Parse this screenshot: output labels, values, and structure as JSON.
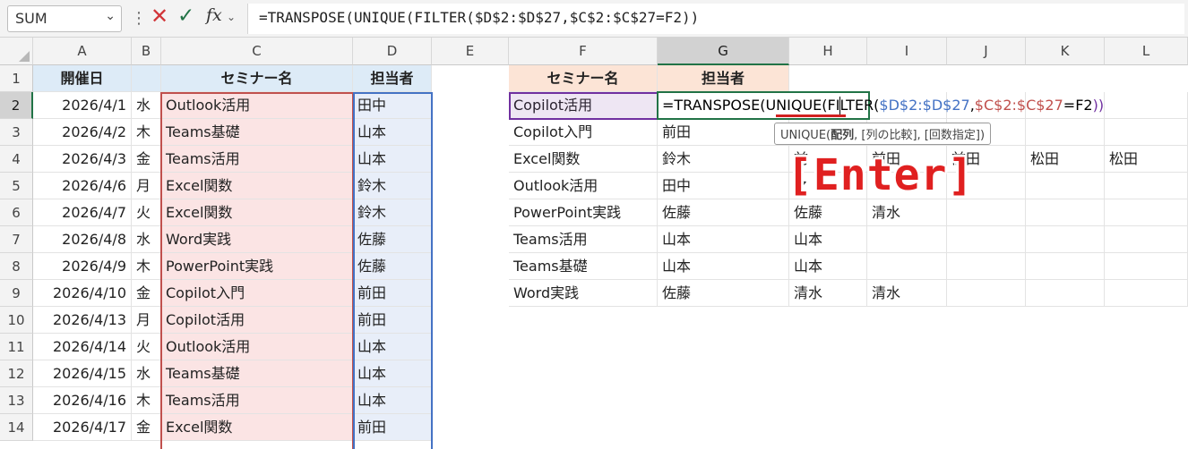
{
  "formula_bar": {
    "name_box": "SUM",
    "cancel_icon": "✕",
    "enter_icon": "✓",
    "fx_label": "fx",
    "formula": "=TRANSPOSE(UNIQUE(FILTER($D$2:$D$27,$C$2:$C$27=F2))"
  },
  "columns": [
    "A",
    "B",
    "C",
    "D",
    "E",
    "F",
    "G",
    "H",
    "I",
    "J",
    "K",
    "L"
  ],
  "rows": [
    "1",
    "2",
    "3",
    "4",
    "5",
    "6",
    "7",
    "8",
    "9",
    "10",
    "11",
    "12",
    "13",
    "14"
  ],
  "selected_column": "G",
  "selected_row": "2",
  "table_left": {
    "headers": {
      "a": "開催日",
      "c": "セミナー名",
      "d": "担当者"
    },
    "rows": [
      {
        "date": "2026/4/1",
        "dow": "水",
        "seminar": "Outlook活用",
        "person": "田中"
      },
      {
        "date": "2026/4/2",
        "dow": "木",
        "seminar": "Teams基礎",
        "person": "山本"
      },
      {
        "date": "2026/4/3",
        "dow": "金",
        "seminar": "Teams活用",
        "person": "山本"
      },
      {
        "date": "2026/4/6",
        "dow": "月",
        "seminar": "Excel関数",
        "person": "鈴木"
      },
      {
        "date": "2026/4/7",
        "dow": "火",
        "seminar": "Excel関数",
        "person": "鈴木"
      },
      {
        "date": "2026/4/8",
        "dow": "水",
        "seminar": "Word実践",
        "person": "佐藤"
      },
      {
        "date": "2026/4/9",
        "dow": "木",
        "seminar": "PowerPoint実践",
        "person": "佐藤"
      },
      {
        "date": "2026/4/10",
        "dow": "金",
        "seminar": "Copilot入門",
        "person": "前田"
      },
      {
        "date": "2026/4/13",
        "dow": "月",
        "seminar": "Copilot活用",
        "person": "前田"
      },
      {
        "date": "2026/4/14",
        "dow": "火",
        "seminar": "Outlook活用",
        "person": "山本"
      },
      {
        "date": "2026/4/15",
        "dow": "水",
        "seminar": "Teams基礎",
        "person": "山本"
      },
      {
        "date": "2026/4/16",
        "dow": "木",
        "seminar": "Teams活用",
        "person": "山本"
      },
      {
        "date": "2026/4/17",
        "dow": "金",
        "seminar": "Excel関数",
        "person": "前田"
      }
    ]
  },
  "table_right": {
    "headers": {
      "f": "セミナー名",
      "g": "担当者"
    },
    "f_values": [
      "Copilot活用",
      "Copilot入門",
      "Excel関数",
      "Outlook活用",
      "PowerPoint実践",
      "Teams活用",
      "Teams基礎",
      "Word実践"
    ],
    "g_values": [
      "",
      "前田",
      "鈴木",
      "田中",
      "佐藤",
      "山本",
      "山本",
      "佐藤"
    ],
    "h_values": [
      "",
      "",
      "",
      "",
      "佐藤",
      "山本",
      "山本",
      "清水"
    ],
    "i_values": [
      "",
      "",
      "前田",
      "",
      "清水",
      "",
      "",
      "清水"
    ],
    "j_values": [
      "",
      "",
      "前田",
      "",
      "",
      "",
      "",
      ""
    ],
    "k_values": [
      "",
      "",
      "松田",
      "",
      "",
      "",
      "",
      ""
    ],
    "l_values": [
      "",
      "",
      "松田",
      "",
      "",
      "",
      "",
      ""
    ],
    "h_row4_partial": "前",
    "h_row5_partial": "之"
  },
  "editor": {
    "part1": "=TRANSPOSE(",
    "part2": "UNIQUE(",
    "part3": "FILTER(",
    "ref1": "$D$2:$D$27",
    "comma": ",",
    "ref2": "$C$2:$C$27",
    "eq": "=F2",
    "close": "))"
  },
  "tooltip": {
    "fn": "UNIQUE(",
    "arg1": "配列",
    "rest": ", [列の比較], [回数指定])"
  },
  "annotation": "[Enter]",
  "colors": {
    "header_left_blue": "#ddebf7",
    "header_orange": "#fce4d6",
    "seminar_pink": "#fbe4e4",
    "person_blue": "#e8eef9",
    "selected_lavender": "#ece6f5",
    "excel_green": "#217346",
    "annotation_red": "#e02020"
  }
}
